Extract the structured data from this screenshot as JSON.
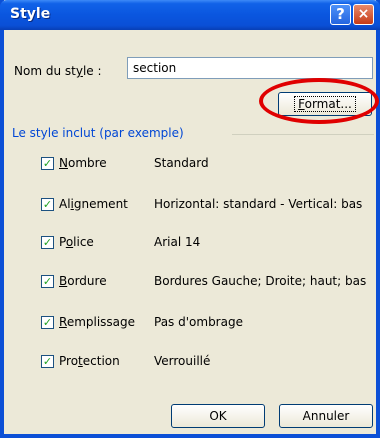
{
  "window": {
    "title": "Style"
  },
  "titlebar": {
    "help": "?",
    "close": "×"
  },
  "style_name": {
    "label_before": "Nom du st",
    "label_mnemonic": "y",
    "label_after": "le :",
    "value": "section"
  },
  "format_button": {
    "mnemonic": "F",
    "rest": "ormat..."
  },
  "group": {
    "label": "Le style inclut (par exemple)"
  },
  "items": [
    {
      "checked": "✓",
      "mn": "N",
      "rest": "ombre",
      "value": "Standard"
    },
    {
      "checked": "✓",
      "pre": "Al",
      "mn": "i",
      "rest": "gnement",
      "value": "Horizontal: standard - Vertical: bas"
    },
    {
      "checked": "✓",
      "pre": "P",
      "mn": "o",
      "rest": "lice",
      "value": "Arial 14"
    },
    {
      "checked": "✓",
      "mn": "B",
      "rest": "ordure",
      "value": "Bordures Gauche; Droite; haut; bas"
    },
    {
      "checked": "✓",
      "mn": "R",
      "rest": "emplissage",
      "value": "Pas d'ombrage"
    },
    {
      "checked": "✓",
      "pre": "Pro",
      "mn": "t",
      "rest": "ection",
      "value": "Verrouillé"
    }
  ],
  "buttons": {
    "ok": "OK",
    "cancel": "Annuler"
  },
  "colors": {
    "titlebar": "#0a56df",
    "group_label": "#0046d5",
    "highlight": "#e00000",
    "dialog_bg": "#ece9d8"
  }
}
